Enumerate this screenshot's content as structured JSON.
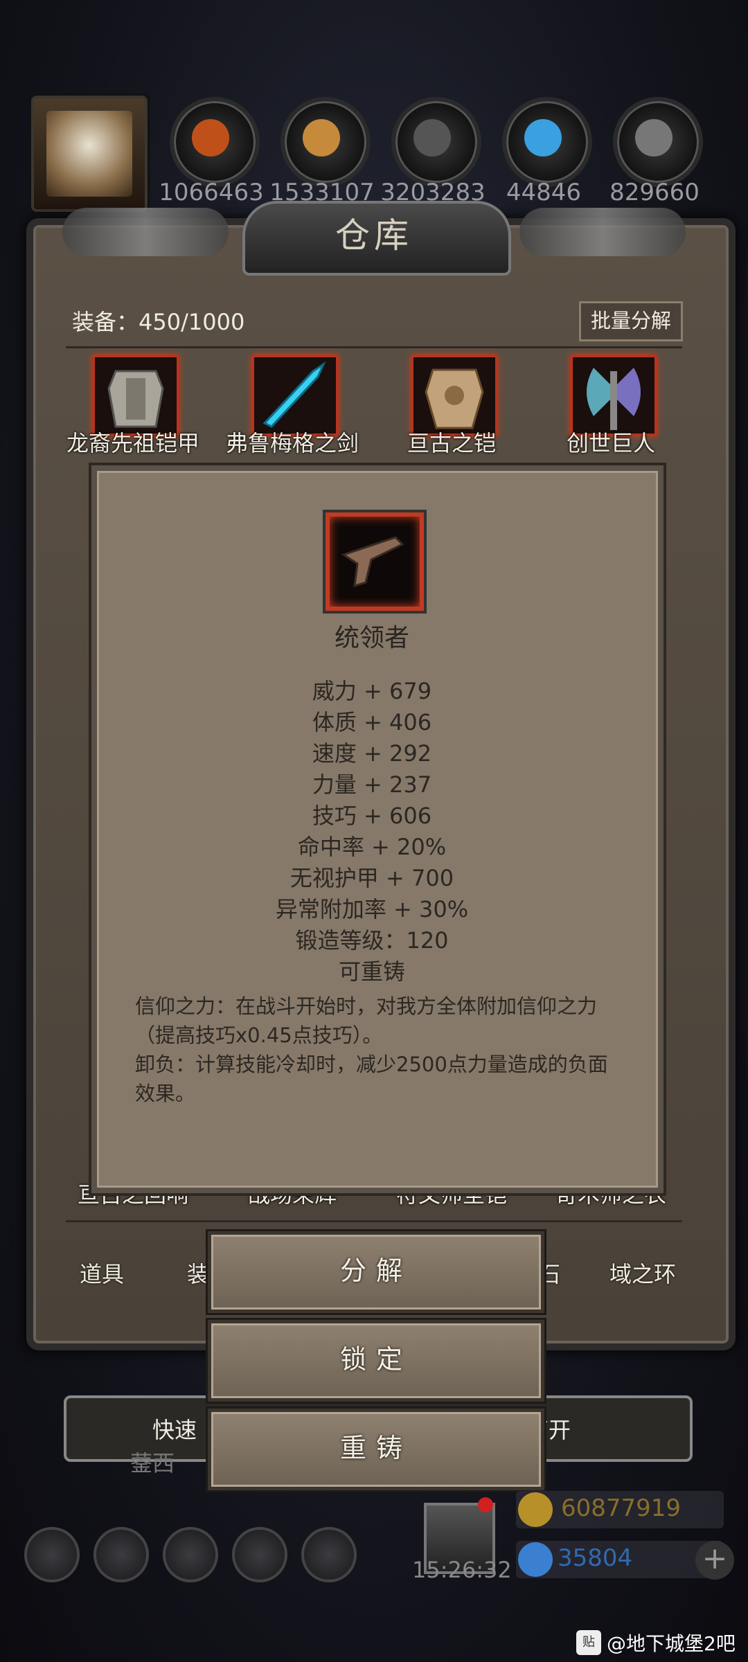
{
  "resources": [
    {
      "name": "resource-orange",
      "color": "#c0501a",
      "count": "1066463"
    },
    {
      "name": "resource-wood",
      "color": "#c58a3a",
      "count": "1533107"
    },
    {
      "name": "resource-iron",
      "color": "#555555",
      "count": "3203283"
    },
    {
      "name": "resource-crystal",
      "color": "#3aa0e0",
      "count": "44846"
    },
    {
      "name": "resource-steel",
      "color": "#777777",
      "count": "829660"
    }
  ],
  "warehouse": {
    "title": "仓库",
    "equip_count": "装备：450/1000",
    "batch_button": "批量分解",
    "top_items": [
      "龙裔先祖铠甲",
      "弗鲁梅格之剑",
      "亘古之铠",
      "创世巨人"
    ],
    "hidden_items": [
      "亘古之回响",
      "战场荣辉",
      "符文师圣铠",
      "奇术师之衣"
    ],
    "tabs": [
      "道具",
      "装",
      "石",
      "域之环"
    ],
    "quick_left": "快速",
    "quick_right": "离开",
    "partial_text": "蓥西"
  },
  "tooltip": {
    "name": "统领者",
    "stats": [
      "威力 + 679",
      "体质 + 406",
      "速度 + 292",
      "力量 + 237",
      "技巧 + 606",
      "命中率 + 20%",
      "无视护甲 + 700",
      "异常附加率 + 30%",
      "锻造等级：120",
      "可重铸"
    ],
    "desc1": "信仰之力：在战斗开始时，对我方全体附加信仰之力（提高技巧x0.45点技巧）。",
    "desc2": "卸负：计算技能冷却时，减少2500点力量造成的负面效果。"
  },
  "actions": {
    "decompose": "分解",
    "lock": "锁定",
    "recast": "重铸"
  },
  "bottom": {
    "time": "15:26:32",
    "gold": "60877919",
    "gems": "35804",
    "watermark": "@地下城堡2吧",
    "wm_icon": "贴"
  },
  "colors": {
    "gold": "#b8902a",
    "gem": "#3a7fd0"
  }
}
